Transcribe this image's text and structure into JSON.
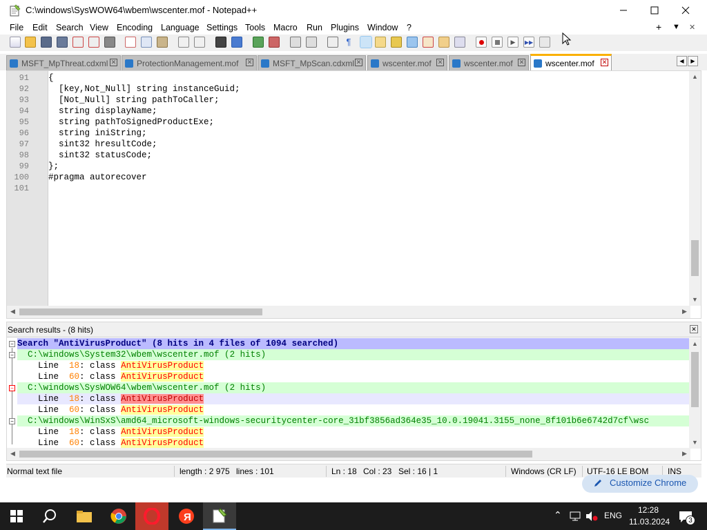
{
  "window": {
    "title": "C:\\windows\\SysWOW64\\wbem\\wscenter.mof - Notepad++",
    "minimize_label": "—",
    "maximize_label": "☐",
    "close_label": "✕"
  },
  "menu": {
    "items": [
      "File",
      "Edit",
      "Search",
      "View",
      "Encoding",
      "Language",
      "Settings",
      "Tools",
      "Macro",
      "Run",
      "Plugins",
      "Window",
      "?"
    ],
    "right_plus": "+",
    "right_down": "▼",
    "right_close": "✕"
  },
  "tabs": [
    {
      "label": "MSFT_MpThreat.cdxml"
    },
    {
      "label": "ProtectionManagement.mof"
    },
    {
      "label": "MSFT_MpScan.cdxml"
    },
    {
      "label": "wscenter.mof"
    },
    {
      "label": "wscenter.mof"
    },
    {
      "label": "wscenter.mof"
    }
  ],
  "editor": {
    "line_numbers": [
      "91",
      "92",
      "93",
      "94",
      "95",
      "96",
      "97",
      "98",
      "99",
      "100",
      "101"
    ],
    "lines": [
      "{",
      "  [key,Not_Null] string instanceGuid;",
      "  [Not_Null] string pathToCaller;",
      "  string displayName;",
      "  string pathToSignedProductExe;",
      "  string iniString;",
      "  sint32 hresultCode;",
      "  sint32 statusCode;",
      "};",
      "#pragma autorecover",
      ""
    ]
  },
  "search_results": {
    "header": "Search results - (8 hits)",
    "summary": "Search \"AntiVirusProduct\" (8 hits in 4 files of 1094 searched)",
    "keyword": "AntiVirusProduct",
    "files": [
      {
        "path": "C:\\windows\\System32\\wbem\\wscenter.mof (2 hits)",
        "hits": [
          {
            "prefix": "Line ",
            "num": " 18",
            "text": ": class "
          },
          {
            "prefix": "Line ",
            "num": " 60",
            "text": ": class "
          }
        ]
      },
      {
        "path": "C:\\windows\\SysWOW64\\wbem\\wscenter.mof (2 hits)",
        "hits": [
          {
            "prefix": "Line ",
            "num": " 18",
            "text": ": class "
          },
          {
            "prefix": "Line ",
            "num": " 60",
            "text": ": class "
          }
        ]
      },
      {
        "path": "C:\\windows\\WinSxS\\amd64_microsoft-windows-securitycenter-core_31bf3856ad364e35_10.0.19041.3155_none_8f101b6e6742d7cf\\wsc",
        "hits": [
          {
            "prefix": "Line ",
            "num": " 18",
            "text": ": class "
          },
          {
            "prefix": "Line ",
            "num": " 60",
            "text": ": class "
          }
        ]
      }
    ]
  },
  "status": {
    "file_type": "Normal text file",
    "length": "length : 2 975",
    "lines": "lines : 101",
    "ln": "Ln : 18",
    "col": "Col : 23",
    "sel": "Sel : 16 | 1",
    "eol": "Windows (CR LF)",
    "encoding": "UTF-16 LE BOM",
    "mode": "INS"
  },
  "chrome_hint": "Customize Chrome",
  "taskbar": {
    "language": "ENG",
    "time": "12:28",
    "date": "11.03.2024",
    "notifications": "3"
  },
  "colors": {
    "active_tab_accent": "#fab000",
    "search_header_bg": "#bbbbff",
    "file_row_bg": "#d5ffd5",
    "keyword_highlight": "#ffff9c",
    "taskbar_bg": "#1c1c1c"
  }
}
